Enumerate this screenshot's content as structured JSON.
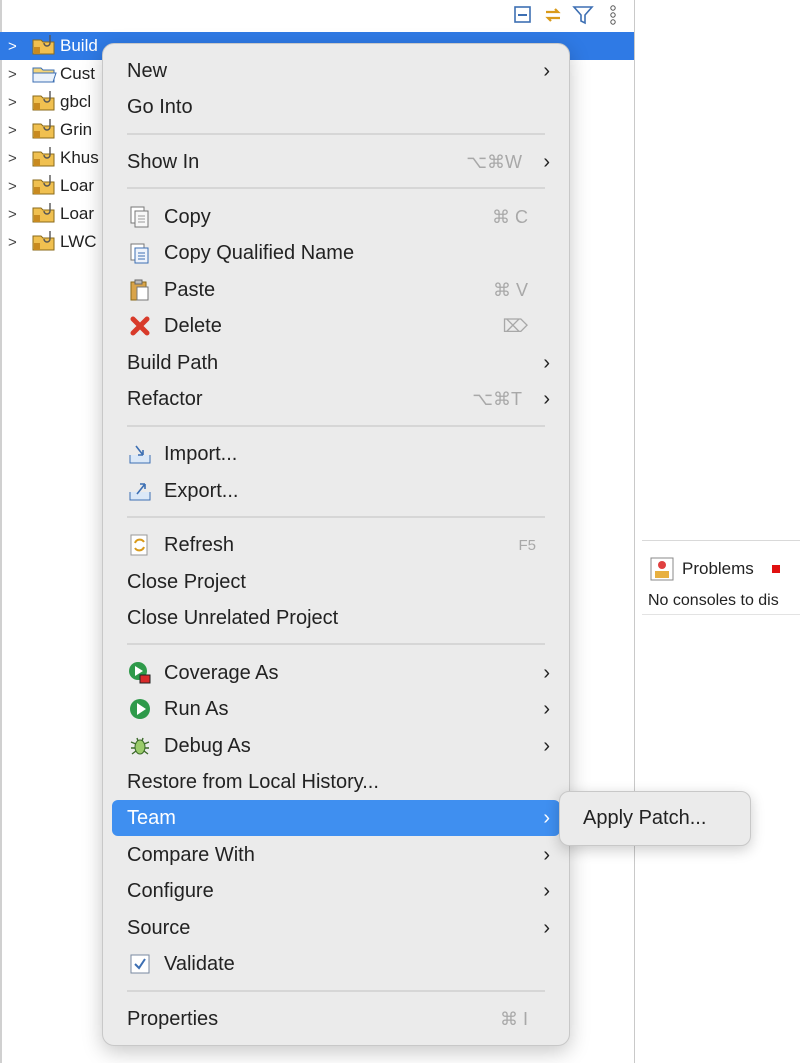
{
  "explorer": {
    "toolbar": [
      "collapse-all-icon",
      "link-with-editor-icon",
      "filter-icon",
      "view-menu-icon"
    ],
    "items": [
      {
        "label": "Build",
        "selected": true
      },
      {
        "label": "Cust"
      },
      {
        "label": "gbcl"
      },
      {
        "label": "Grin"
      },
      {
        "label": "Khus"
      },
      {
        "label": "Loar"
      },
      {
        "label": "Loar"
      },
      {
        "label": "LWC"
      }
    ]
  },
  "views": {
    "problems_tab": "Problems",
    "console_message": "No consoles to dis"
  },
  "menu": {
    "items": [
      {
        "label": "New",
        "arrow": "›"
      },
      {
        "label": "Go Into"
      },
      {
        "label": "Show In",
        "shortcut": "⌥⌘W",
        "arrow": "›"
      },
      {
        "label": "Copy",
        "shortcut": "⌘ C",
        "icon": "copy-icon"
      },
      {
        "label": "Copy Qualified Name",
        "icon": "copy-qualified-name-icon"
      },
      {
        "label": "Paste",
        "shortcut": "⌘ V",
        "icon": "paste-icon"
      },
      {
        "label": "Delete",
        "shortcut": "⌦",
        "icon": "delete-icon"
      },
      {
        "label": "Build Path",
        "arrow": "›"
      },
      {
        "label": "Refactor",
        "shortcut": "⌥⌘T",
        "arrow": "›"
      },
      {
        "label": "Import...",
        "icon": "import-icon"
      },
      {
        "label": "Export...",
        "icon": "export-icon"
      },
      {
        "label": "Refresh",
        "shortcut": "F5",
        "icon": "refresh-icon"
      },
      {
        "label": "Close Project"
      },
      {
        "label": "Close Unrelated Project"
      },
      {
        "label": "Coverage As",
        "arrow": "›",
        "icon": "coverage-icon"
      },
      {
        "label": "Run As",
        "arrow": "›",
        "icon": "run-icon"
      },
      {
        "label": "Debug As",
        "arrow": "›",
        "icon": "debug-icon"
      },
      {
        "label": "Restore from Local History..."
      },
      {
        "label": "Team",
        "arrow": "›",
        "active": true
      },
      {
        "label": "Compare With",
        "arrow": "›"
      },
      {
        "label": "Configure",
        "arrow": "›"
      },
      {
        "label": "Source",
        "arrow": "›"
      },
      {
        "label": "Validate",
        "icon": "checkbox-icon"
      },
      {
        "label": "Properties",
        "shortcut": "⌘ I"
      }
    ]
  },
  "submenu": {
    "items": [
      {
        "label": "Apply Patch..."
      }
    ]
  },
  "colors": {
    "selection": "#2f7ae5",
    "menu_highlight": "#3f8ff0",
    "menu_background": "#ebebeb"
  }
}
